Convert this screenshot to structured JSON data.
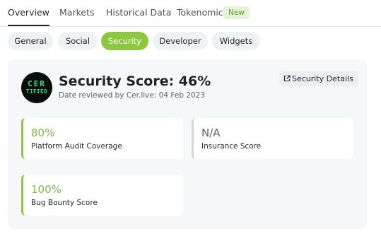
{
  "tabs": [
    "Overview",
    "Markets",
    "Historical Data",
    "Tokenomics"
  ],
  "tokenomics_badge": "New",
  "subtabs": [
    "General",
    "Social",
    "Security",
    "Developer",
    "Widgets"
  ],
  "security": {
    "logo_line1": "CER",
    "logo_line2": "TIFIED",
    "title": "Security Score: 46%",
    "reviewed": "Date reviewed by Cer.live: 04 Feb 2023",
    "details_label": "Security Details"
  },
  "metrics": [
    {
      "value": "80%",
      "label": "Platform Audit Coverage"
    },
    {
      "value": "N/A",
      "label": "Insurance Score"
    },
    {
      "value": "100%",
      "label": "Bug Bounty Score"
    }
  ],
  "colors": {
    "accent_green": "#8dc63f",
    "panel_bg": "#f6f7f8",
    "logo_green": "#2fe383"
  }
}
